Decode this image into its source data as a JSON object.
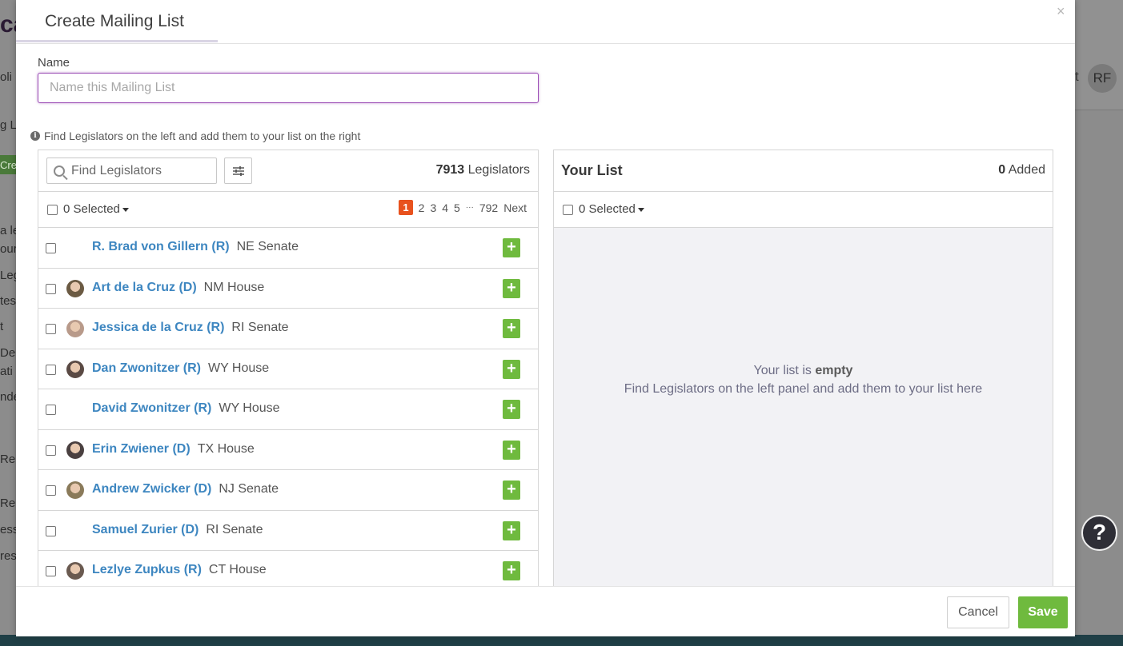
{
  "background": {
    "logo_fragment": "ca",
    "left_fragments": [
      "oli",
      "g L",
      "Cre",
      "a le",
      "our",
      "Leg",
      "tes",
      "t",
      "De",
      "ati",
      "nde",
      "Rep",
      "Rep",
      "ess",
      "res"
    ],
    "right_fragment": "t",
    "user_initials": "RF"
  },
  "modal": {
    "title": "Create Mailing List",
    "close_symbol": "×",
    "name_label": "Name",
    "name_placeholder": "Name this Mailing List",
    "name_value": "",
    "hint": "Find Legislators on the left and add them to your list on the right"
  },
  "left_panel": {
    "search_placeholder": "Find Legislators",
    "count_number": "7913",
    "count_label": "Legislators",
    "selected_label": "0 Selected",
    "pagination": {
      "current": "1",
      "pages": [
        "2",
        "3",
        "4",
        "5"
      ],
      "ellipsis": "···",
      "last": "792",
      "next": "Next"
    },
    "legislators": [
      {
        "name": "R. Brad von Gillern (R)",
        "chamber": "NE Senate",
        "has_photo": false
      },
      {
        "name": "Art de la Cruz (D)",
        "chamber": "NM House",
        "has_photo": true,
        "photo_color": "#6b5a43"
      },
      {
        "name": "Jessica de la Cruz (R)",
        "chamber": "RI Senate",
        "has_photo": true,
        "photo_color": "#b89a8a"
      },
      {
        "name": "Dan Zwonitzer (R)",
        "chamber": "WY House",
        "has_photo": true,
        "photo_color": "#5a4a44"
      },
      {
        "name": "David Zwonitzer (R)",
        "chamber": "WY House",
        "has_photo": false
      },
      {
        "name": "Erin Zwiener (D)",
        "chamber": "TX House",
        "has_photo": true,
        "photo_color": "#4a4040"
      },
      {
        "name": "Andrew Zwicker (D)",
        "chamber": "NJ Senate",
        "has_photo": true,
        "photo_color": "#8a7a5a"
      },
      {
        "name": "Samuel Zurier (D)",
        "chamber": "RI Senate",
        "has_photo": false
      },
      {
        "name": "Lezlye Zupkus (R)",
        "chamber": "CT House",
        "has_photo": true,
        "photo_color": "#6a5a50"
      }
    ],
    "add_symbol": "+"
  },
  "right_panel": {
    "title": "Your List",
    "added_count": "0",
    "added_label": "Added",
    "selected_label": "0 Selected",
    "empty_prefix": "Your list is",
    "empty_bold": "empty",
    "empty_line2": "Find Legislators on the left panel and add them to your list here"
  },
  "footer": {
    "cancel_label": "Cancel",
    "save_label": "Save"
  },
  "help_symbol": "?",
  "colors": {
    "accent_purple": "#9a4bb4",
    "link_blue": "#3d86c0",
    "add_green": "#6fba3e",
    "page_active": "#e8521e"
  }
}
